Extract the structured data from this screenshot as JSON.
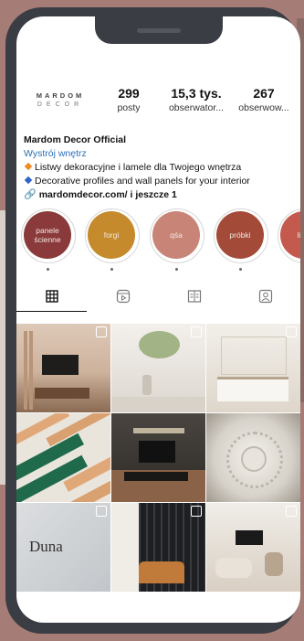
{
  "profile": {
    "logo_line1": "MARDOM",
    "logo_line2": "DECOR",
    "stats": [
      {
        "num": "299",
        "label": "posty"
      },
      {
        "num": "15,3 tys.",
        "label": "obserwator..."
      },
      {
        "num": "267",
        "label": "obserwow..."
      }
    ],
    "name": "Mardom Decor Official",
    "category": "Wystrój wnętrz",
    "bio_line1": "Listwy dekoracyjne i lamele dla Twojego wnętrza",
    "bio_line2": "Decorative profiles and wall panels for your interior",
    "link": "mardomdecor.com/ i jeszcze 1"
  },
  "highlights": [
    {
      "label": "panele ścienne",
      "color": "#8a3a3a"
    },
    {
      "label": "forgi",
      "color": "#c58a2c"
    },
    {
      "label": "qśa",
      "color": "#c98478"
    },
    {
      "label": "próbki",
      "color": "#a44a38"
    },
    {
      "label": "lista",
      "color": "#c45a4e"
    }
  ],
  "tabs": [
    {
      "icon": "grid-icon"
    },
    {
      "icon": "reels-icon"
    },
    {
      "icon": "guide-icon"
    },
    {
      "icon": "tagged-icon"
    }
  ],
  "posts": [
    {
      "desc": "living room with wood panels",
      "colors": [
        "#d8c2b0",
        "#8a6a52"
      ]
    },
    {
      "desc": "white bathroom with plant",
      "colors": [
        "#f1eeea",
        "#c8c2b8"
      ]
    },
    {
      "desc": "bedroom with white moldings",
      "colors": [
        "#efece7",
        "#c9bfb2"
      ]
    },
    {
      "desc": "green and wood lamel samples",
      "colors": [
        "#1f6a4a",
        "#d9a478"
      ]
    },
    {
      "desc": "dark room with tv panel",
      "colors": [
        "#3a3632",
        "#a07a5a"
      ]
    },
    {
      "desc": "ornate ceiling rosette",
      "colors": [
        "#ddd8d0",
        "#8f8980"
      ]
    },
    {
      "desc": "Duna",
      "colors": [
        "#d4d6d8",
        "#b8bcc0"
      ]
    },
    {
      "desc": "dark slat wall with chair",
      "colors": [
        "#2a2b2e",
        "#c07a3a"
      ]
    },
    {
      "desc": "minimal living room",
      "colors": [
        "#eeebe6",
        "#b7a590"
      ]
    }
  ],
  "duna_text": "Duna"
}
